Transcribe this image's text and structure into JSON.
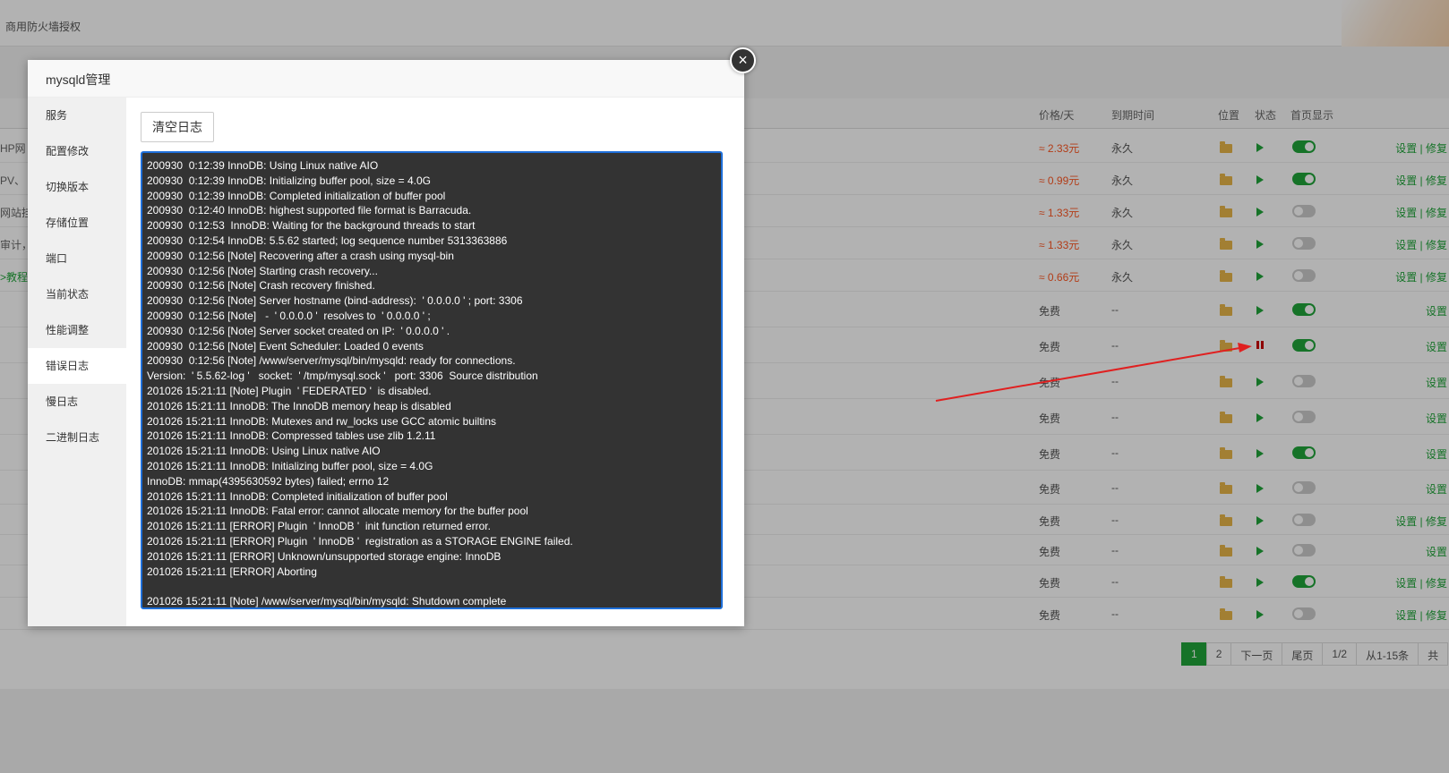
{
  "app": {
    "title": "商用防火墙授权"
  },
  "table": {
    "headers": {
      "price": "价格/天",
      "expire": "到期时间",
      "location": "位置",
      "status": "状态",
      "home": "首页显示"
    },
    "rows": [
      {
        "left": "HP网",
        "left_green": false,
        "price": "≈ 2.33元",
        "expire": "永久",
        "running": true,
        "home": true,
        "actions": "设置 | 修复"
      },
      {
        "left": "PV、",
        "left_green": false,
        "price": "≈ 0.99元",
        "expire": "永久",
        "running": true,
        "home": true,
        "actions": "设置 | 修复"
      },
      {
        "left": "网站挂",
        "left_green": false,
        "price": "≈ 1.33元",
        "expire": "永久",
        "running": true,
        "home": false,
        "actions": "设置 | 修复"
      },
      {
        "left": "审计，",
        "left_green": false,
        "price": "≈ 1.33元",
        "expire": "永久",
        "running": true,
        "home": false,
        "actions": "设置 | 修复"
      },
      {
        "left": ">教程",
        "left_green": true,
        "price": "≈ 0.66元",
        "expire": "永久",
        "running": true,
        "home": false,
        "actions": "设置 | 修复"
      },
      {
        "left": "",
        "left_green": false,
        "price": "免费",
        "expire": "--",
        "running": true,
        "home": true,
        "actions": "设置"
      },
      {
        "left": "",
        "left_green": false,
        "price": "免费",
        "expire": "--",
        "running": false,
        "home": true,
        "actions": "设置"
      },
      {
        "left": "",
        "left_green": false,
        "price": "免费",
        "expire": "--",
        "running": true,
        "home": false,
        "actions": "设置"
      },
      {
        "left": "",
        "left_green": false,
        "price": "免费",
        "expire": "--",
        "running": true,
        "home": false,
        "actions": "设置"
      },
      {
        "left": "",
        "left_green": false,
        "price": "免费",
        "expire": "--",
        "running": true,
        "home": true,
        "actions": "设置"
      },
      {
        "left": "",
        "left_green": false,
        "price": "免费",
        "expire": "--",
        "running": true,
        "home": false,
        "actions": "设置"
      },
      {
        "left": "",
        "left_green": false,
        "price": "免费",
        "expire": "--",
        "running": true,
        "home": false,
        "actions": "设置 | 修复"
      },
      {
        "left": "",
        "left_green": false,
        "price": "免费",
        "expire": "--",
        "running": true,
        "home": false,
        "actions": "设置"
      },
      {
        "left": "",
        "left_green": false,
        "price": "免费",
        "expire": "--",
        "running": true,
        "home": true,
        "actions": "设置 | 修复"
      },
      {
        "left": "",
        "left_green": false,
        "price": "免费",
        "expire": "--",
        "running": true,
        "home": false,
        "actions": "设置 | 修复"
      }
    ]
  },
  "pager": {
    "page1": "1",
    "page2": "2",
    "next": "下一页",
    "last": "尾页",
    "info": "1/2",
    "range": "从1-15条",
    "total": "共"
  },
  "modal": {
    "title": "mysqld管理",
    "close_icon": "×",
    "sidebar": [
      "服务",
      "配置修改",
      "切换版本",
      "存储位置",
      "端口",
      "当前状态",
      "性能调整",
      "错误日志",
      "慢日志",
      "二进制日志"
    ],
    "active_index": 7,
    "clear_button": "清空日志",
    "log_lines": [
      "200930  0:12:39 InnoDB: Using Linux native AIO",
      "200930  0:12:39 InnoDB: Initializing buffer pool, size = 4.0G",
      "200930  0:12:39 InnoDB: Completed initialization of buffer pool",
      "200930  0:12:40 InnoDB: highest supported file format is Barracuda.",
      "200930  0:12:53  InnoDB: Waiting for the background threads to start",
      "200930  0:12:54 InnoDB: 5.5.62 started; log sequence number 5313363886",
      "200930  0:12:56 [Note] Recovering after a crash using mysql-bin",
      "200930  0:12:56 [Note] Starting crash recovery...",
      "200930  0:12:56 [Note] Crash recovery finished.",
      "200930  0:12:56 [Note] Server hostname (bind-address):  ' 0.0.0.0 ' ; port: 3306",
      "200930  0:12:56 [Note]   -  ' 0.0.0.0 '  resolves to  ' 0.0.0.0 ' ;",
      "200930  0:12:56 [Note] Server socket created on IP:  ' 0.0.0.0 ' .",
      "200930  0:12:56 [Note] Event Scheduler: Loaded 0 events",
      "200930  0:12:56 [Note] /www/server/mysql/bin/mysqld: ready for connections.",
      "Version:  ' 5.5.62-log '   socket:  ' /tmp/mysql.sock '   port: 3306  Source distribution",
      "201026 15:21:11 [Note] Plugin  ' FEDERATED '  is disabled.",
      "201026 15:21:11 InnoDB: The InnoDB memory heap is disabled",
      "201026 15:21:11 InnoDB: Mutexes and rw_locks use GCC atomic builtins",
      "201026 15:21:11 InnoDB: Compressed tables use zlib 1.2.11",
      "201026 15:21:11 InnoDB: Using Linux native AIO",
      "201026 15:21:11 InnoDB: Initializing buffer pool, size = 4.0G",
      "InnoDB: mmap(4395630592 bytes) failed; errno 12",
      "201026 15:21:11 InnoDB: Completed initialization of buffer pool",
      "201026 15:21:11 InnoDB: Fatal error: cannot allocate memory for the buffer pool",
      "201026 15:21:11 [ERROR] Plugin  ' InnoDB '  init function returned error.",
      "201026 15:21:11 [ERROR] Plugin  ' InnoDB '  registration as a STORAGE ENGINE failed.",
      "201026 15:21:11 [ERROR] Unknown/unsupported storage engine: InnoDB",
      "201026 15:21:11 [ERROR] Aborting",
      "",
      "201026 15:21:11 [Note] /www/server/mysql/bin/mysqld: Shutdown complete"
    ]
  },
  "annotation": {
    "arrow_color": "#e02020"
  }
}
